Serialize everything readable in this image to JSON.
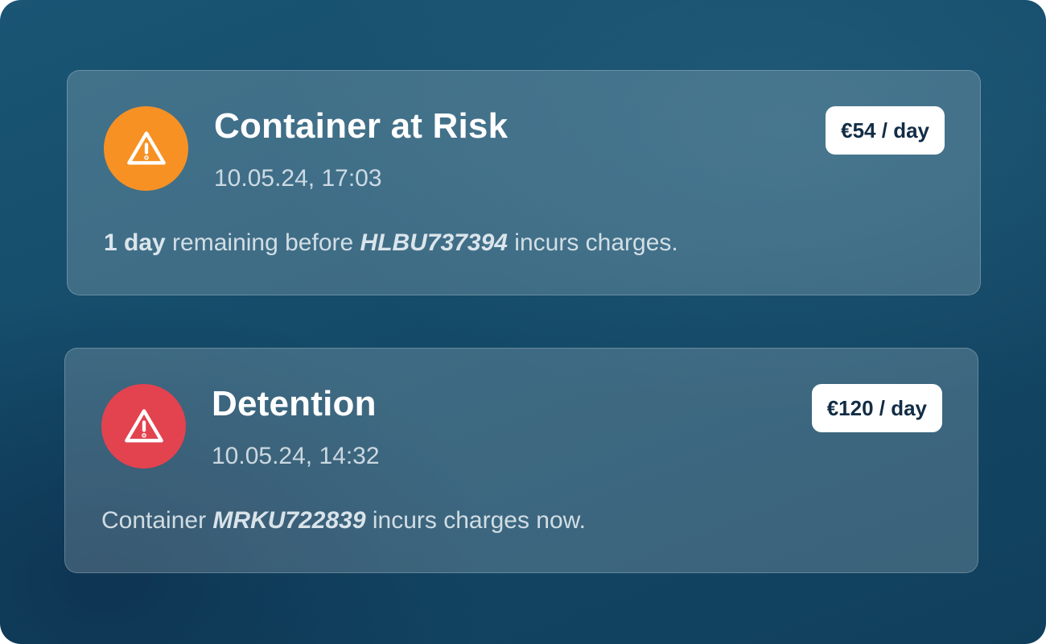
{
  "colors": {
    "risk_icon_bg": "#f79124",
    "detention_icon_bg": "#e2434f",
    "badge_bg": "#ffffff",
    "badge_text": "#122c45"
  },
  "notifications": [
    {
      "icon": "warning-triangle-icon",
      "title": "Container at Risk",
      "timestamp": "10.05.24, 17:03",
      "rate": "€54 / day",
      "message": {
        "lead_bold": "1 day",
        "pre": " remaining before ",
        "container_id": "HLBU737394",
        "post": " incurs charges."
      }
    },
    {
      "icon": "warning-triangle-icon",
      "title": "Detention",
      "timestamp": "10.05.24, 14:32",
      "rate": "€120 / day",
      "message": {
        "pre": "Container ",
        "container_id": "MRKU722839",
        "post": " incurs charges now."
      }
    }
  ]
}
